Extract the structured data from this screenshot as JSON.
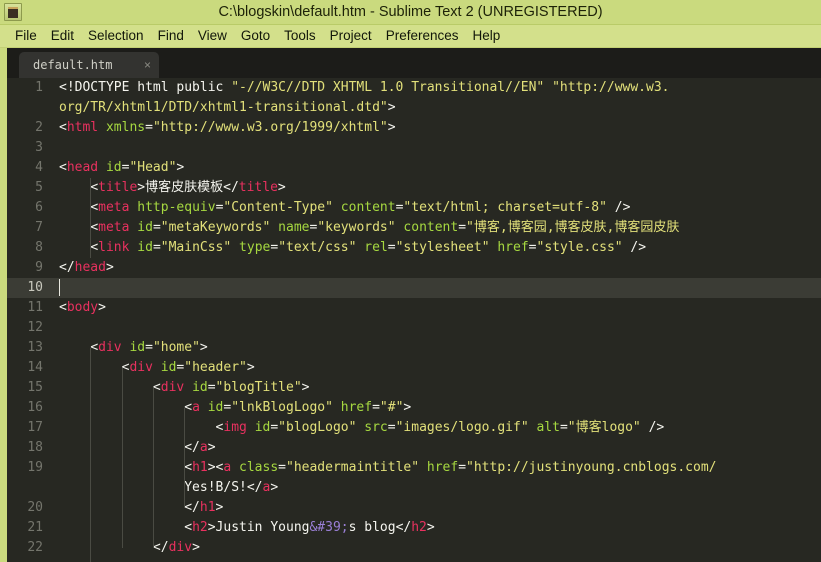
{
  "window": {
    "title": "C:\\blogskin\\default.htm - Sublime Text 2 (UNREGISTERED)",
    "icon": "sublime-text-icon",
    "titlebar_color": "#cada7e",
    "menubar_color": "#d3e08b",
    "editor_bg": "#272822"
  },
  "menu": {
    "items": [
      {
        "label": "File"
      },
      {
        "label": "Edit"
      },
      {
        "label": "Selection"
      },
      {
        "label": "Find"
      },
      {
        "label": "View"
      },
      {
        "label": "Goto"
      },
      {
        "label": "Tools"
      },
      {
        "label": "Project"
      },
      {
        "label": "Preferences"
      },
      {
        "label": "Help"
      }
    ]
  },
  "tabs": [
    {
      "label": "default.htm",
      "close": "×",
      "active": true
    }
  ],
  "editor": {
    "active_line": 10,
    "syntax_colors": {
      "tag": "#e8315f",
      "attribute": "#a6d840",
      "string": "#e2e07a",
      "text": "#f5f5ef",
      "entity": "#9a7fd6",
      "line_number": "#74756c"
    },
    "lines": [
      {
        "num": "1",
        "tokens": [
          {
            "t": "txt",
            "v": "<!DOCTYPE html public "
          },
          {
            "t": "str",
            "v": "\"-//W3C//DTD XHTML 1.0 Transitional//EN\""
          },
          {
            "t": "txt",
            "v": " "
          },
          {
            "t": "str",
            "v": "\"http://www.w3."
          }
        ]
      },
      {
        "num": "",
        "tokens": [
          {
            "t": "str",
            "v": "org/TR/xhtml1/DTD/xhtml1-transitional.dtd\""
          },
          {
            "t": "txt",
            "v": ">"
          }
        ]
      },
      {
        "num": "2",
        "tokens": [
          {
            "t": "punct",
            "v": "<"
          },
          {
            "t": "tag",
            "v": "html"
          },
          {
            "t": "txt",
            "v": " "
          },
          {
            "t": "attr",
            "v": "xmlns"
          },
          {
            "t": "txt",
            "v": "="
          },
          {
            "t": "str",
            "v": "\"http://www.w3.org/1999/xhtml\""
          },
          {
            "t": "punct",
            "v": ">"
          }
        ]
      },
      {
        "num": "3",
        "tokens": []
      },
      {
        "num": "4",
        "tokens": [
          {
            "t": "punct",
            "v": "<"
          },
          {
            "t": "tag",
            "v": "head"
          },
          {
            "t": "txt",
            "v": " "
          },
          {
            "t": "attr",
            "v": "id"
          },
          {
            "t": "txt",
            "v": "="
          },
          {
            "t": "str",
            "v": "\"Head\""
          },
          {
            "t": "punct",
            "v": ">"
          }
        ]
      },
      {
        "num": "5",
        "tokens": [
          {
            "t": "txt",
            "v": "    "
          },
          {
            "t": "punct",
            "v": "<"
          },
          {
            "t": "tag",
            "v": "title"
          },
          {
            "t": "punct",
            "v": ">"
          },
          {
            "t": "txt",
            "v": "博客皮肤模板"
          },
          {
            "t": "punct",
            "v": "</"
          },
          {
            "t": "tag",
            "v": "title"
          },
          {
            "t": "punct",
            "v": ">"
          }
        ]
      },
      {
        "num": "6",
        "tokens": [
          {
            "t": "txt",
            "v": "    "
          },
          {
            "t": "punct",
            "v": "<"
          },
          {
            "t": "tag",
            "v": "meta"
          },
          {
            "t": "txt",
            "v": " "
          },
          {
            "t": "attr",
            "v": "http-equiv"
          },
          {
            "t": "txt",
            "v": "="
          },
          {
            "t": "str",
            "v": "\"Content-Type\""
          },
          {
            "t": "txt",
            "v": " "
          },
          {
            "t": "attr",
            "v": "content"
          },
          {
            "t": "txt",
            "v": "="
          },
          {
            "t": "str",
            "v": "\"text/html; charset=utf-8\""
          },
          {
            "t": "punct",
            "v": " />"
          }
        ]
      },
      {
        "num": "7",
        "tokens": [
          {
            "t": "txt",
            "v": "    "
          },
          {
            "t": "punct",
            "v": "<"
          },
          {
            "t": "tag",
            "v": "meta"
          },
          {
            "t": "txt",
            "v": " "
          },
          {
            "t": "attr",
            "v": "id"
          },
          {
            "t": "txt",
            "v": "="
          },
          {
            "t": "str",
            "v": "\"metaKeywords\""
          },
          {
            "t": "txt",
            "v": " "
          },
          {
            "t": "attr",
            "v": "name"
          },
          {
            "t": "txt",
            "v": "="
          },
          {
            "t": "str",
            "v": "\"keywords\""
          },
          {
            "t": "txt",
            "v": " "
          },
          {
            "t": "attr",
            "v": "content"
          },
          {
            "t": "txt",
            "v": "="
          },
          {
            "t": "str",
            "v": "\"博客,博客园,博客皮肤,博客园皮肤"
          }
        ]
      },
      {
        "num": "8",
        "tokens": [
          {
            "t": "txt",
            "v": "    "
          },
          {
            "t": "punct",
            "v": "<"
          },
          {
            "t": "tag",
            "v": "link"
          },
          {
            "t": "txt",
            "v": " "
          },
          {
            "t": "attr",
            "v": "id"
          },
          {
            "t": "txt",
            "v": "="
          },
          {
            "t": "str",
            "v": "\"MainCss\""
          },
          {
            "t": "txt",
            "v": " "
          },
          {
            "t": "attr",
            "v": "type"
          },
          {
            "t": "txt",
            "v": "="
          },
          {
            "t": "str",
            "v": "\"text/css\""
          },
          {
            "t": "txt",
            "v": " "
          },
          {
            "t": "attr",
            "v": "rel"
          },
          {
            "t": "txt",
            "v": "="
          },
          {
            "t": "str",
            "v": "\"stylesheet\""
          },
          {
            "t": "txt",
            "v": " "
          },
          {
            "t": "attr",
            "v": "href"
          },
          {
            "t": "txt",
            "v": "="
          },
          {
            "t": "str",
            "v": "\"style.css\""
          },
          {
            "t": "punct",
            "v": " />"
          }
        ]
      },
      {
        "num": "9",
        "tokens": [
          {
            "t": "punct",
            "v": "</"
          },
          {
            "t": "tag",
            "v": "head"
          },
          {
            "t": "punct",
            "v": ">"
          }
        ]
      },
      {
        "num": "10",
        "tokens": [],
        "active": true
      },
      {
        "num": "11",
        "tokens": [
          {
            "t": "punct",
            "v": "<"
          },
          {
            "t": "tag",
            "v": "body"
          },
          {
            "t": "punct",
            "v": ">"
          }
        ]
      },
      {
        "num": "12",
        "tokens": []
      },
      {
        "num": "13",
        "tokens": [
          {
            "t": "txt",
            "v": "    "
          },
          {
            "t": "punct",
            "v": "<"
          },
          {
            "t": "tag",
            "v": "div"
          },
          {
            "t": "txt",
            "v": " "
          },
          {
            "t": "attr",
            "v": "id"
          },
          {
            "t": "txt",
            "v": "="
          },
          {
            "t": "str",
            "v": "\"home\""
          },
          {
            "t": "punct",
            "v": ">"
          }
        ]
      },
      {
        "num": "14",
        "tokens": [
          {
            "t": "txt",
            "v": "        "
          },
          {
            "t": "punct",
            "v": "<"
          },
          {
            "t": "tag",
            "v": "div"
          },
          {
            "t": "txt",
            "v": " "
          },
          {
            "t": "attr",
            "v": "id"
          },
          {
            "t": "txt",
            "v": "="
          },
          {
            "t": "str",
            "v": "\"header\""
          },
          {
            "t": "punct",
            "v": ">"
          }
        ]
      },
      {
        "num": "15",
        "tokens": [
          {
            "t": "txt",
            "v": "            "
          },
          {
            "t": "punct",
            "v": "<"
          },
          {
            "t": "tag",
            "v": "div"
          },
          {
            "t": "txt",
            "v": " "
          },
          {
            "t": "attr",
            "v": "id"
          },
          {
            "t": "txt",
            "v": "="
          },
          {
            "t": "str",
            "v": "\"blogTitle\""
          },
          {
            "t": "punct",
            "v": ">"
          }
        ]
      },
      {
        "num": "16",
        "tokens": [
          {
            "t": "txt",
            "v": "                "
          },
          {
            "t": "punct",
            "v": "<"
          },
          {
            "t": "tag",
            "v": "a"
          },
          {
            "t": "txt",
            "v": " "
          },
          {
            "t": "attr",
            "v": "id"
          },
          {
            "t": "txt",
            "v": "="
          },
          {
            "t": "str",
            "v": "\"lnkBlogLogo\""
          },
          {
            "t": "txt",
            "v": " "
          },
          {
            "t": "attr",
            "v": "href"
          },
          {
            "t": "txt",
            "v": "="
          },
          {
            "t": "str",
            "v": "\"#\""
          },
          {
            "t": "punct",
            "v": ">"
          }
        ]
      },
      {
        "num": "17",
        "tokens": [
          {
            "t": "txt",
            "v": "                    "
          },
          {
            "t": "punct",
            "v": "<"
          },
          {
            "t": "tag",
            "v": "img"
          },
          {
            "t": "txt",
            "v": " "
          },
          {
            "t": "attr",
            "v": "id"
          },
          {
            "t": "txt",
            "v": "="
          },
          {
            "t": "str",
            "v": "\"blogLogo\""
          },
          {
            "t": "txt",
            "v": " "
          },
          {
            "t": "attr",
            "v": "src"
          },
          {
            "t": "txt",
            "v": "="
          },
          {
            "t": "str",
            "v": "\"images/logo.gif\""
          },
          {
            "t": "txt",
            "v": " "
          },
          {
            "t": "attr",
            "v": "alt"
          },
          {
            "t": "txt",
            "v": "="
          },
          {
            "t": "str",
            "v": "\"博客logo\""
          },
          {
            "t": "punct",
            "v": " />"
          }
        ]
      },
      {
        "num": "18",
        "tokens": [
          {
            "t": "txt",
            "v": "                "
          },
          {
            "t": "punct",
            "v": "</"
          },
          {
            "t": "tag",
            "v": "a"
          },
          {
            "t": "punct",
            "v": ">"
          }
        ]
      },
      {
        "num": "19",
        "tokens": [
          {
            "t": "txt",
            "v": "                "
          },
          {
            "t": "punct",
            "v": "<"
          },
          {
            "t": "tag",
            "v": "h1"
          },
          {
            "t": "punct",
            "v": "><"
          },
          {
            "t": "tag",
            "v": "a"
          },
          {
            "t": "txt",
            "v": " "
          },
          {
            "t": "attr",
            "v": "class"
          },
          {
            "t": "txt",
            "v": "="
          },
          {
            "t": "str",
            "v": "\"headermaintitle\""
          },
          {
            "t": "txt",
            "v": " "
          },
          {
            "t": "attr",
            "v": "href"
          },
          {
            "t": "txt",
            "v": "="
          },
          {
            "t": "str",
            "v": "\"http://justinyoung.cnblogs.com/"
          }
        ]
      },
      {
        "num": "",
        "tokens": [
          {
            "t": "txt",
            "v": "                "
          },
          {
            "t": "txt",
            "v": "Yes!B/S!"
          },
          {
            "t": "punct",
            "v": "</"
          },
          {
            "t": "tag",
            "v": "a"
          },
          {
            "t": "punct",
            "v": ">"
          }
        ]
      },
      {
        "num": "20",
        "tokens": [
          {
            "t": "txt",
            "v": "                "
          },
          {
            "t": "punct",
            "v": "</"
          },
          {
            "t": "tag",
            "v": "h1"
          },
          {
            "t": "punct",
            "v": ">"
          }
        ]
      },
      {
        "num": "21",
        "tokens": [
          {
            "t": "txt",
            "v": "                "
          },
          {
            "t": "punct",
            "v": "<"
          },
          {
            "t": "tag",
            "v": "h2"
          },
          {
            "t": "punct",
            "v": ">"
          },
          {
            "t": "txt",
            "v": "Justin Young"
          },
          {
            "t": "ent",
            "v": "&#39;"
          },
          {
            "t": "txt",
            "v": "s blog"
          },
          {
            "t": "punct",
            "v": "</"
          },
          {
            "t": "tag",
            "v": "h2"
          },
          {
            "t": "punct",
            "v": ">"
          }
        ]
      },
      {
        "num": "22",
        "tokens": [
          {
            "t": "txt",
            "v": "            "
          },
          {
            "t": "punct",
            "v": "</"
          },
          {
            "t": "tag",
            "v": "div"
          },
          {
            "t": "punct",
            "v": ">"
          }
        ]
      }
    ]
  }
}
